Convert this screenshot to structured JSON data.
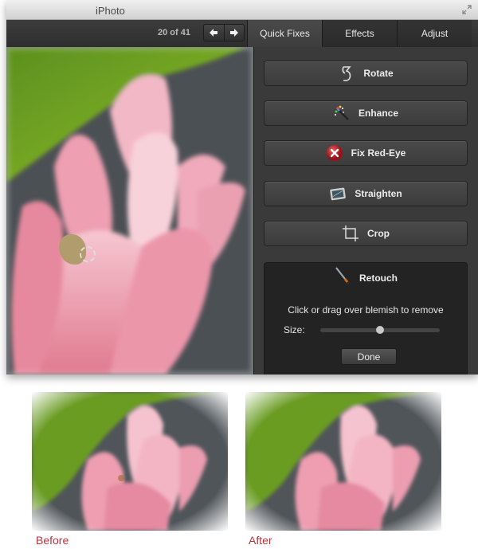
{
  "window": {
    "title": "iPhoto",
    "counter": "20 of 41",
    "nav": {
      "prev_icon": "arrow-left-icon",
      "next_icon": "arrow-right-icon"
    }
  },
  "tabs": [
    {
      "label": "Quick Fixes",
      "active": true
    },
    {
      "label": "Effects",
      "active": false
    },
    {
      "label": "Adjust",
      "active": false
    }
  ],
  "quick_fixes": [
    {
      "label": "Rotate",
      "icon": "rotate-icon"
    },
    {
      "label": "Enhance",
      "icon": "magic-wand-icon"
    },
    {
      "label": "Fix Red-Eye",
      "icon": "red-eye-icon"
    },
    {
      "label": "Straighten",
      "icon": "straighten-icon"
    },
    {
      "label": "Crop",
      "icon": "crop-icon"
    }
  ],
  "retouch": {
    "label": "Retouch",
    "icon": "brush-icon",
    "hint": "Click or drag over blemish to remove",
    "size_label": "Size:",
    "size_value": 0.5,
    "done_label": "Done"
  },
  "captions": {
    "before": "Before",
    "after": "After"
  },
  "colors": {
    "caption": "#b8343c",
    "panel_bg": "#3a3a3a",
    "red_eye": "#c0202a"
  }
}
